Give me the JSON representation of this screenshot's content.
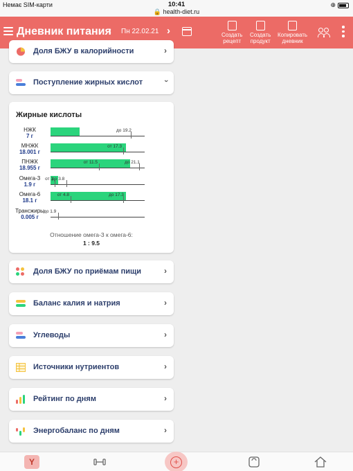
{
  "status_bar": {
    "carrier": "Немає SIM-карти",
    "time": "10:41",
    "url": "health-diet.ru"
  },
  "header": {
    "title": "Дневник питания",
    "date": "Пн 22.02.21",
    "actions": [
      {
        "line1": "Создать",
        "line2": "рецепт"
      },
      {
        "line1": "Создать",
        "line2": "продукт"
      },
      {
        "line1": "Копировать",
        "line2": "дневник"
      }
    ]
  },
  "sections_top": [
    {
      "label": "Доля БЖУ в калорийности",
      "icon": "pie-chart-icon",
      "state": "collapsed"
    },
    {
      "label": "Поступление жирных кислот",
      "icon": "stacked-bars-icon",
      "state": "expanded"
    }
  ],
  "fatty_acids_card": {
    "title": "Жирные кислоты",
    "ratio_label": "Отношение омега-3 к омега-6:",
    "ratio_value": "1 : 9.5"
  },
  "chart_data": {
    "type": "bar",
    "orientation": "horizontal",
    "title": "Жирные кислоты",
    "categories": [
      "НЖК",
      "МНЖК",
      "ПНЖК",
      "Омега-3",
      "Омега-6",
      "Трансжиры"
    ],
    "values": [
      7,
      18.001,
      18.955,
      1.9,
      18.1,
      0.005
    ],
    "value_labels": [
      "7 г",
      "18.001 г",
      "18.955 г",
      "1.9 г",
      "18.1 г",
      "0.005 г"
    ],
    "norm_min": [
      null,
      17.3,
      11.5,
      1,
      4.8,
      null
    ],
    "norm_max": [
      19.2,
      null,
      21.1,
      3.8,
      17.3,
      1.9
    ],
    "norm_min_labels": [
      "",
      "от 17.3",
      "от 11.5",
      "от 1",
      "от 4.8",
      ""
    ],
    "norm_max_labels": [
      "до 19.2",
      "",
      "до 21.1",
      "до 3.8",
      "до 17.3",
      "до 1.9"
    ],
    "colors": {
      "bar": "#2bd47c"
    }
  },
  "sections_bottom": [
    {
      "label": "Доля БЖУ по приёмам пищи",
      "icon": "dots-grid-icon"
    },
    {
      "label": "Баланс калия и натрия",
      "icon": "balance-bars-icon"
    },
    {
      "label": "Углеводы",
      "icon": "carbs-bars-icon"
    },
    {
      "label": "Источники нутриентов",
      "icon": "table-icon"
    },
    {
      "label": "Рейтинг по дням",
      "icon": "bar-rating-icon"
    },
    {
      "label": "Энергобаланс по дням",
      "icon": "energy-bars-icon"
    }
  ],
  "colors": {
    "header": "#ec6b66",
    "accent_green": "#2bd47c",
    "label_blue": "#2c3e6b"
  }
}
